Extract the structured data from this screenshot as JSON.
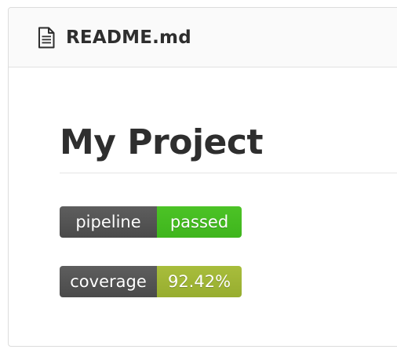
{
  "file": {
    "name": "README.md",
    "icon": "file-text-icon"
  },
  "readme": {
    "title": "My Project",
    "badges": [
      {
        "label": "pipeline",
        "value": "passed",
        "color": "#44cc11"
      },
      {
        "label": "coverage",
        "value": "92.42%",
        "color": "#a4b839"
      }
    ]
  },
  "colors": {
    "badge_label_bg": "#555555",
    "text": "#2e2e2e"
  }
}
